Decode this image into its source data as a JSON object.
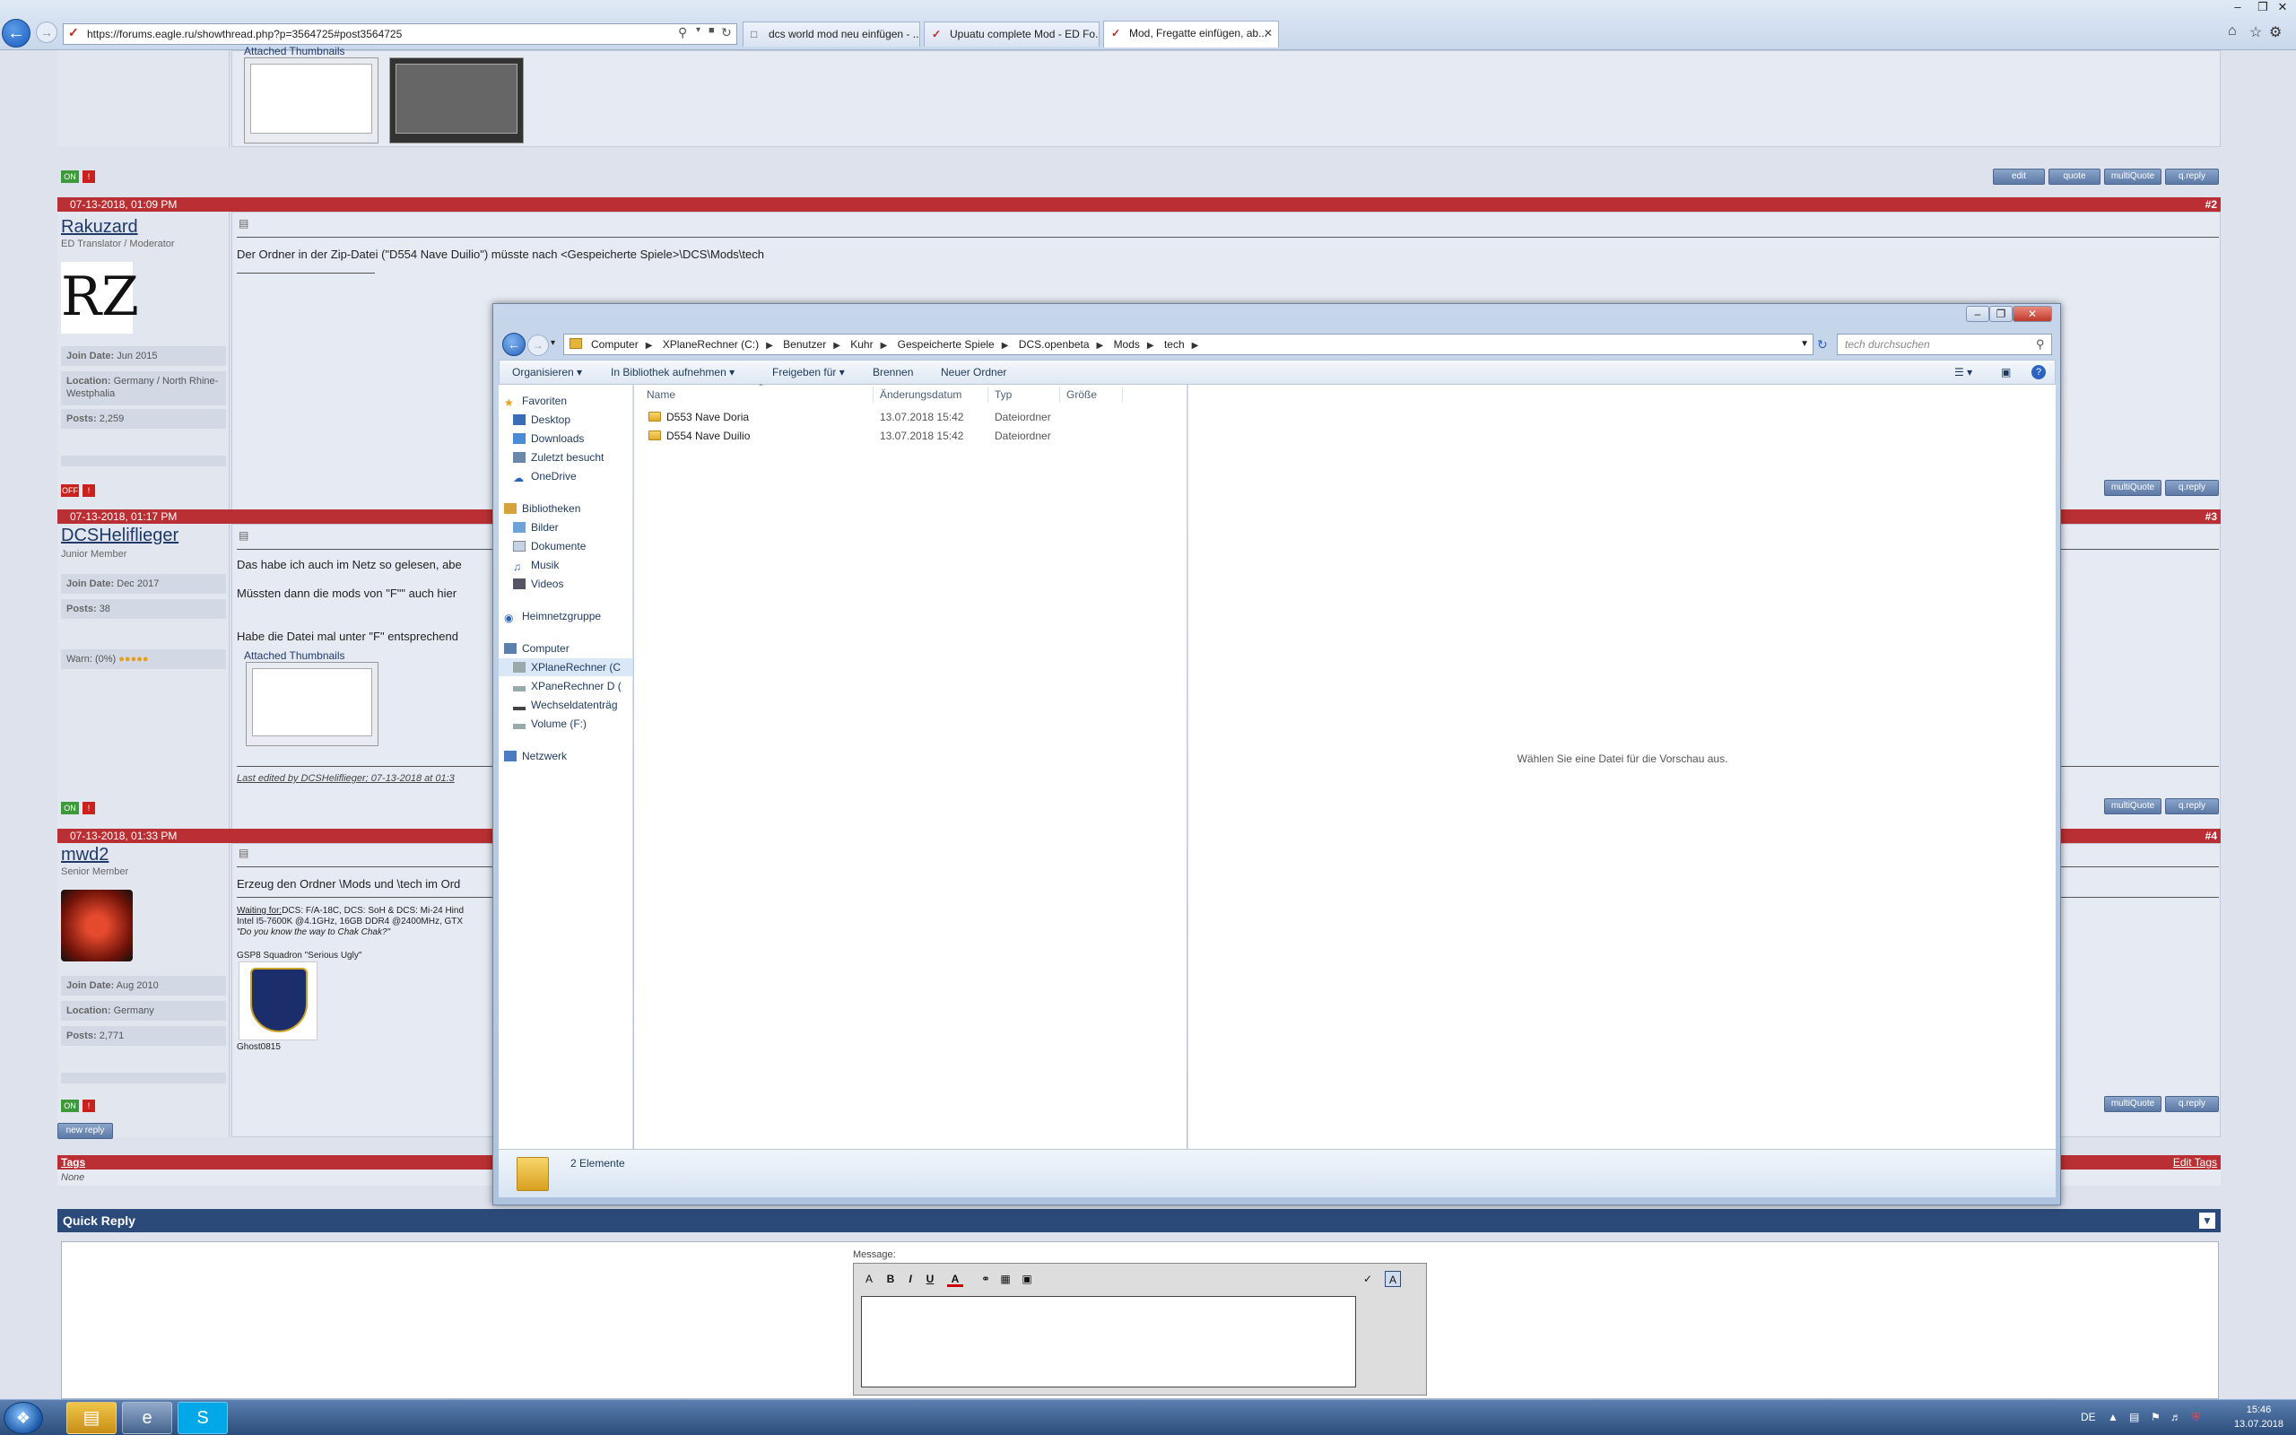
{
  "browser": {
    "url": "https://forums.eagle.ru/showthread.php?p=3564725#post3564725",
    "tabs": [
      {
        "label": "dcs world mod neu einfügen - ..."
      },
      {
        "label": "Upuatu complete Mod - ED Fo..."
      },
      {
        "label": "Mod, Fregatte einfügen, ab..."
      }
    ]
  },
  "posts": [
    {
      "date": "07-13-2018, 01:09 PM",
      "number": "#2",
      "username": "Rakuzard",
      "role": "ED Translator / Moderator",
      "avatar_text": "RZ",
      "info": [
        {
          "label": "Join Date:",
          "value": "Jun 2015"
        },
        {
          "label": "Location:",
          "value": "Germany / North Rhine-Westphalia"
        },
        {
          "label": "Posts:",
          "value": "2,259"
        }
      ],
      "text": "Der Ordner in der Zip-Datei (\"D554 Nave Duilio\") müsste nach <Gespeicherte Spiele>\\DCS\\Mods\\tech",
      "badge": "OFF"
    },
    {
      "date": "07-13-2018, 01:17 PM",
      "number": "#3",
      "username": "DCSHeliflieger",
      "role": "Junior Member",
      "info": [
        {
          "label": "Join Date:",
          "value": "Dec 2017"
        },
        {
          "label": "Posts:",
          "value": "38"
        }
      ],
      "warn": "Warn: (0%)",
      "lines": [
        "Das habe ich auch im Netz so gelesen, abe",
        "Müssten dann die mods von \"F\"\" auch hier",
        "Habe die Datei mal unter \"F\" entsprechend"
      ],
      "attached": "Attached Thumbnails",
      "edited": "Last edited by DCSHeliflieger; 07-13-2018 at 01:3",
      "badge": "ON"
    },
    {
      "date": "07-13-2018, 01:33 PM",
      "number": "#4",
      "username": "mwd2",
      "role": "Senior Member",
      "info": [
        {
          "label": "Join Date:",
          "value": "Aug 2010"
        },
        {
          "label": "Location:",
          "value": "Germany"
        },
        {
          "label": "Posts:",
          "value": "2,771"
        }
      ],
      "text": "Erzeug den Ordner \\Mods und \\tech im Ord",
      "sig_waiting_label": "Waiting for:",
      "sig_waiting": "DCS: F/A-18C, DCS: SoH & DCS: Mi-24 Hind",
      "sig_pc": "Intel I5-7600K @4.1GHz, 16GB DDR4 @2400MHz, GTX",
      "sig_quote": "\"Do you know the way to Chak Chak?\"",
      "sig_squadron": "GSP8 Squadron \"Serious Ugly\"",
      "sig_name": "Ghost0815",
      "badge": "ON"
    }
  ],
  "post0": {
    "attached": "Attached Thumbnails",
    "badge": "ON"
  },
  "post_buttons": {
    "edit": "edit",
    "quote": "quote",
    "multiquote": "multiQuote",
    "qreply": "q.reply"
  },
  "new_reply": "new reply",
  "tags": {
    "label": "Tags",
    "value": "None",
    "edit": "Edit Tags"
  },
  "quick_reply": {
    "title": "Quick Reply",
    "message_label": "Message:"
  },
  "explorer": {
    "breadcrumb": [
      "Computer",
      "XPlaneRechner (C:)",
      "Benutzer",
      "Kuhr",
      "Gespeicherte Spiele",
      "DCS.openbeta",
      "Mods",
      "tech"
    ],
    "search_placeholder": "tech durchsuchen",
    "toolbar": {
      "organize": "Organisieren",
      "library": "In Bibliothek aufnehmen",
      "share": "Freigeben für",
      "burn": "Brennen",
      "new_folder": "Neuer Ordner"
    },
    "nav": {
      "favorites": "Favoriten",
      "fav_items": [
        "Desktop",
        "Downloads",
        "Zuletzt besucht",
        "OneDrive"
      ],
      "libraries": "Bibliotheken",
      "lib_items": [
        "Bilder",
        "Dokumente",
        "Musik",
        "Videos"
      ],
      "homegroup": "Heimnetzgruppe",
      "computer": "Computer",
      "comp_items": [
        "XPlaneRechner (C",
        "XPaneRechner D (",
        "Wechseldatenträg",
        "Volume (F:)"
      ],
      "network": "Netzwerk"
    },
    "columns": {
      "name": "Name",
      "date": "Änderungsdatum",
      "type": "Typ",
      "size": "Größe"
    },
    "files": [
      {
        "name": "D553 Nave Doria",
        "date": "13.07.2018 15:42",
        "type": "Dateiordner"
      },
      {
        "name": "D554 Nave Duilio",
        "date": "13.07.2018 15:42",
        "type": "Dateiordner"
      }
    ],
    "preview_msg": "Wählen Sie eine Datei für die Vorschau aus.",
    "status": "2 Elemente"
  },
  "taskbar": {
    "lang": "DE",
    "time": "15:46",
    "date": "13.07.2018"
  }
}
